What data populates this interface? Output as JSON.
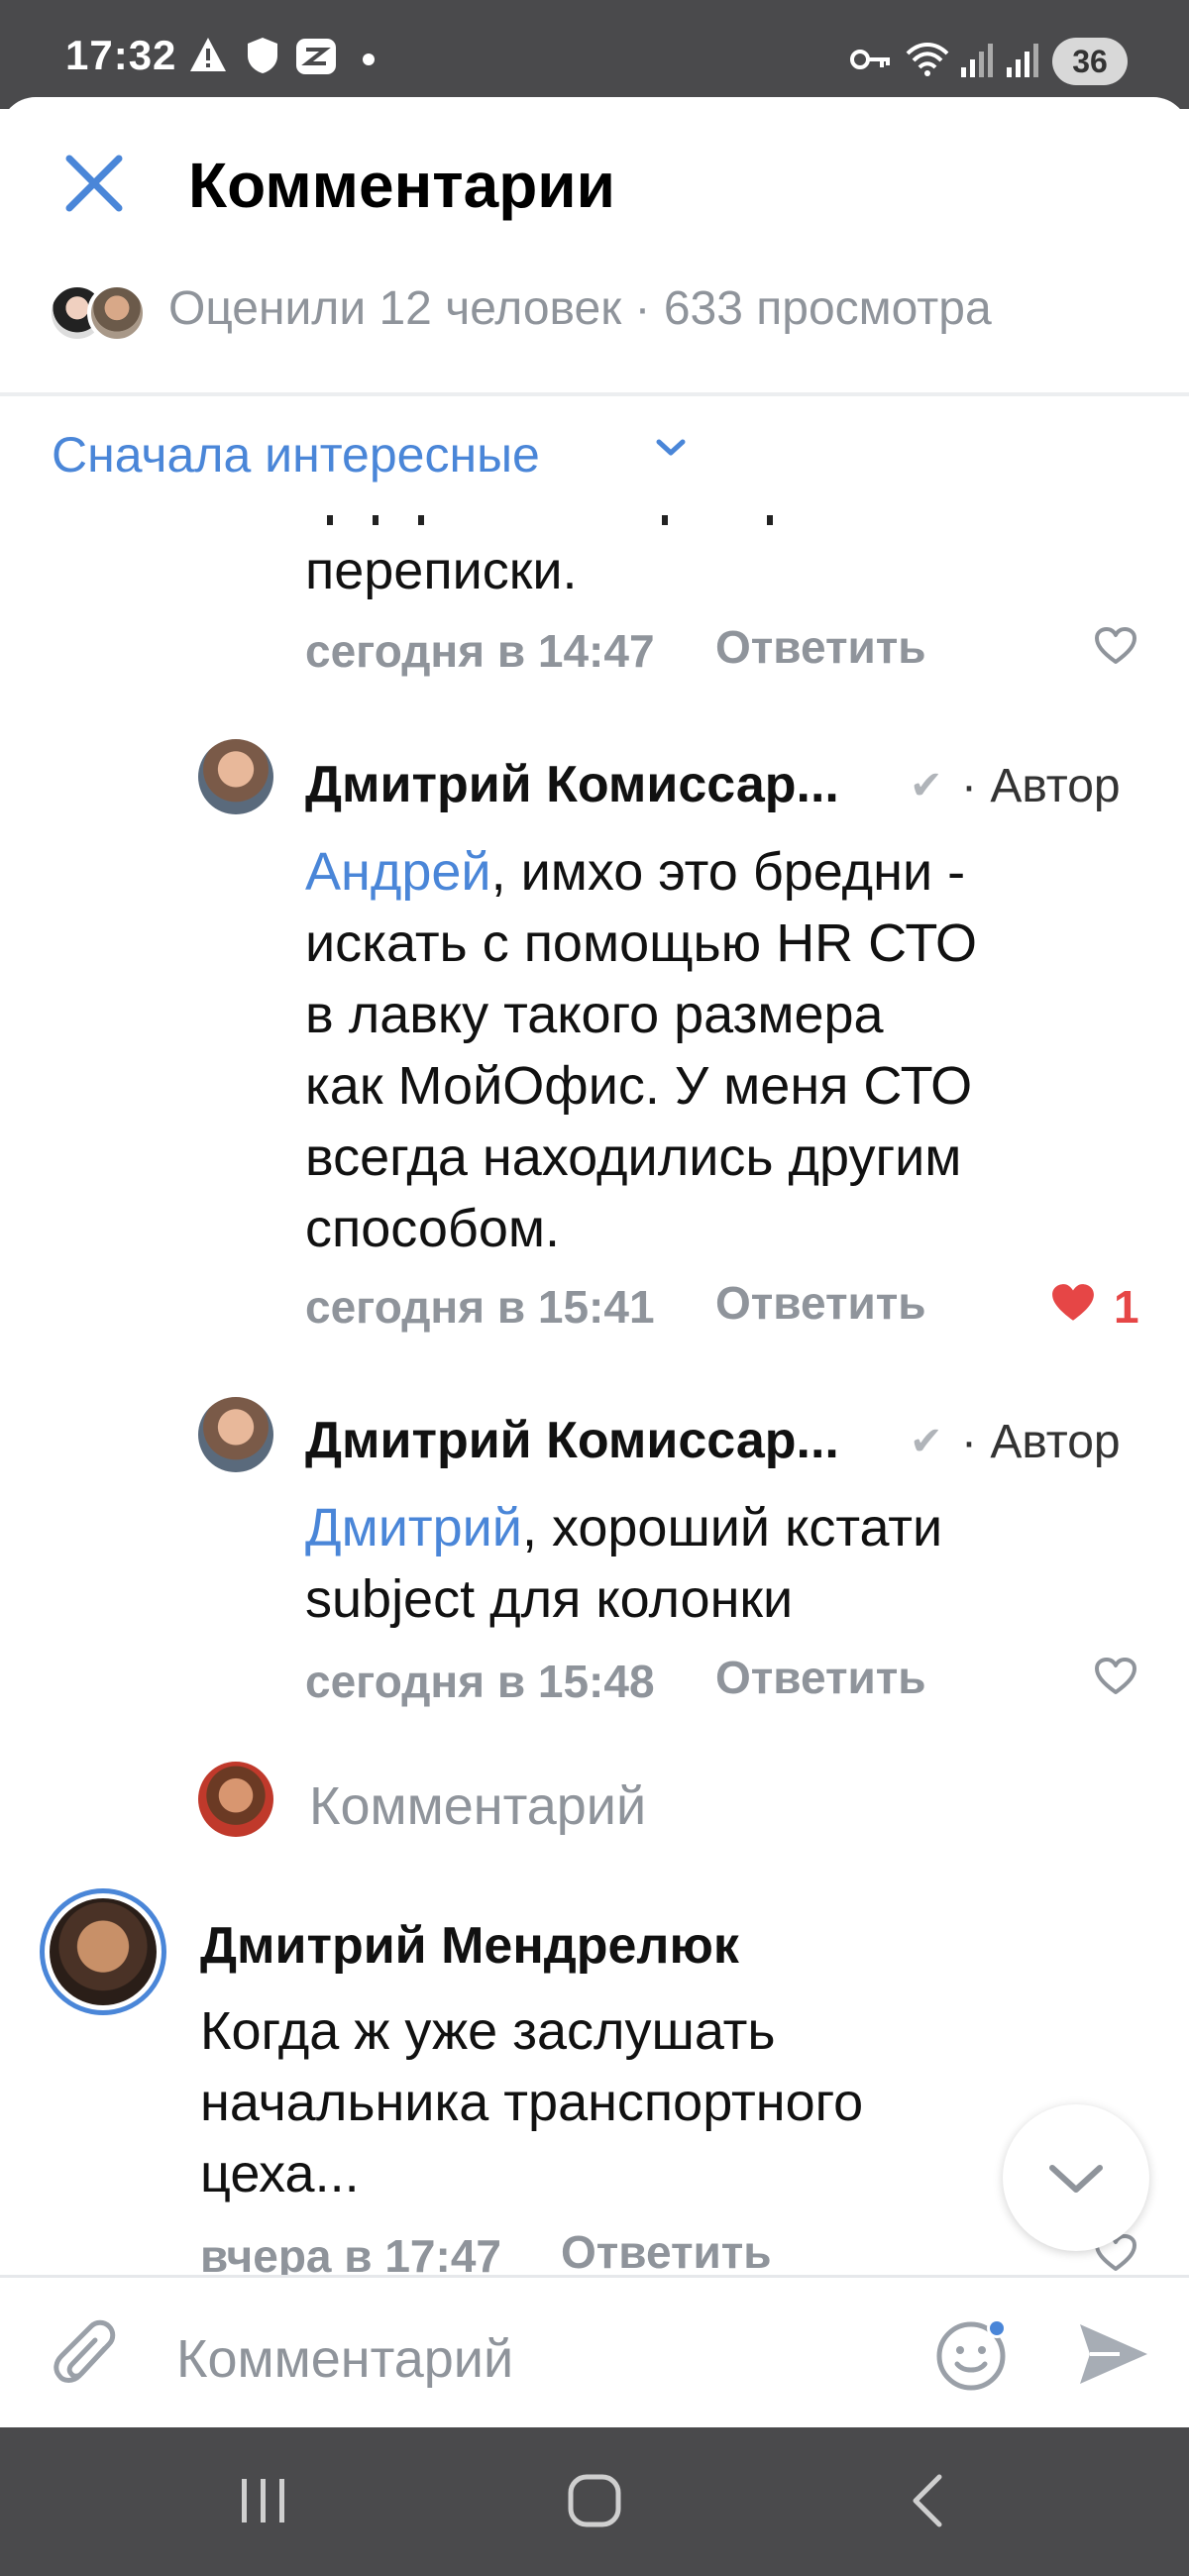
{
  "status_bar": {
    "time": "17:32",
    "battery": "36",
    "icons": [
      "warning-icon",
      "shield-icon",
      "app-icon",
      "dot-icon",
      "key-icon",
      "wifi-icon",
      "signal-icon",
      "signal-icon"
    ]
  },
  "header": {
    "title": "Комментарии",
    "close_icon": "close-icon",
    "liked_summary": "Оценили 12 человек · 633 просмотра"
  },
  "sort": {
    "label": "Сначала интересные"
  },
  "comments": [
    {
      "text_tail": "переписки.",
      "time": "сегодня в 14:47",
      "reply_label": "Ответить",
      "likes": ""
    },
    {
      "author": "Дмитрий Комиссар...",
      "author_tag": "· Автор",
      "mention": "Андрей",
      "text_line1": ", имхо это бредни -",
      "text_rest": [
        "искать с помощью HR СТО",
        "в лавку такого размера",
        "как МойОфис. У меня СТО",
        "всегда находились другим",
        "способом."
      ],
      "time": "сегодня в 15:41",
      "reply_label": "Ответить",
      "likes": "1"
    },
    {
      "author": "Дмитрий Комиссар...",
      "author_tag": "· Автор",
      "mention": "Дмитрий",
      "text_line1": ", хороший кстати",
      "text_rest": [
        "subject для колонки"
      ],
      "time": "сегодня в 15:48",
      "reply_label": "Ответить",
      "likes": ""
    }
  ],
  "inline_reply_placeholder": "Комментарий",
  "top_comment": {
    "author": "Дмитрий Мендрелюк",
    "text_lines": [
      "Когда ж уже заслушать",
      "начальника транспортного",
      "цеха..."
    ],
    "time": "вчера в 17:47",
    "reply_label": "Ответить"
  },
  "composer": {
    "placeholder": "Комментарий"
  },
  "colors": {
    "accent": "#4a86d8",
    "like_active": "#e64646",
    "muted": "#8f949b",
    "statusbar_bg": "#4a4a4c"
  }
}
